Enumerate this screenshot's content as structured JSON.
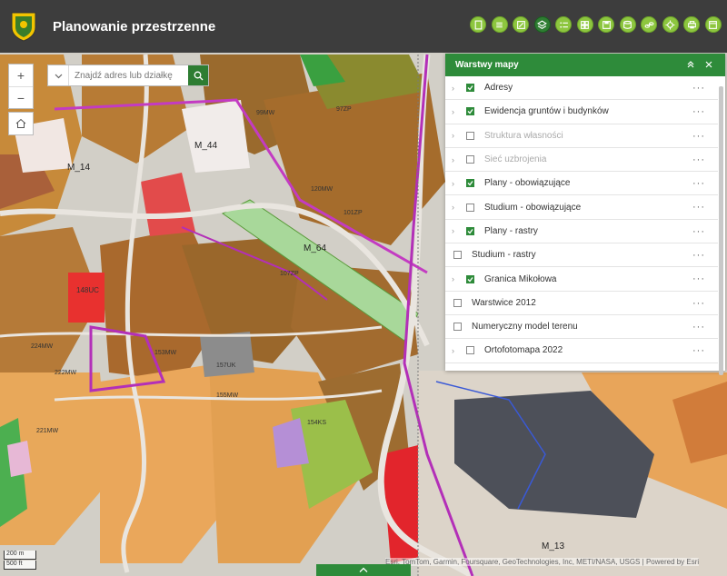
{
  "header": {
    "title": "Planowanie przestrzenne",
    "logo_icon": "crest-icon"
  },
  "toolbar": {
    "tools": [
      "document-icon",
      "list-icon",
      "frame-icon",
      "layers-icon",
      "legend-icon",
      "grid-icon",
      "save-icon",
      "database-icon",
      "link-icon",
      "locate-icon",
      "print-icon",
      "window-icon"
    ],
    "active_tool": "layers-icon",
    "accent": "#8dc63f"
  },
  "search": {
    "placeholder": "Znajdź adres lub działkę"
  },
  "zoom": {
    "plus": "+",
    "minus": "−"
  },
  "map_labels": {
    "m44": "M_44",
    "m14": "M_14",
    "m64": "M_64",
    "m13": "M_13",
    "u148": "148UC",
    "r120": "120MW",
    "r153": "153MW",
    "r157": "157UK",
    "r97": "97ZP",
    "r99": "99MW",
    "r222": "222MW",
    "r224": "224MW",
    "r221": "221MW",
    "r155": "155MW",
    "r154": "154KS",
    "r107": "107ZP",
    "r101": "101ZP"
  },
  "panel": {
    "title": "Warstwy mapy",
    "layers": [
      {
        "label": "Adresy",
        "checked": true,
        "chevron": true,
        "dim": false
      },
      {
        "label": "Ewidencja gruntów i budynków",
        "checked": true,
        "chevron": true,
        "dim": false
      },
      {
        "label": "Struktura własności",
        "checked": false,
        "chevron": true,
        "dim": true
      },
      {
        "label": "Sieć uzbrojenia",
        "checked": false,
        "chevron": true,
        "dim": true
      },
      {
        "label": "Plany - obowiązujące",
        "checked": true,
        "chevron": true,
        "dim": false
      },
      {
        "label": "Studium - obowiązujące",
        "checked": false,
        "chevron": true,
        "dim": false
      },
      {
        "label": "Plany - rastry",
        "checked": true,
        "chevron": true,
        "dim": false
      },
      {
        "label": "Studium - rastry",
        "checked": false,
        "chevron": false,
        "dim": false
      },
      {
        "label": "Granica Mikołowa",
        "checked": true,
        "chevron": true,
        "dim": false
      },
      {
        "label": "Warstwice 2012",
        "checked": false,
        "chevron": false,
        "dim": false
      },
      {
        "label": "Numeryczny model terenu",
        "checked": false,
        "chevron": false,
        "dim": false
      },
      {
        "label": "Ortofotomapa 2022",
        "checked": false,
        "chevron": true,
        "dim": false
      }
    ],
    "more": "···"
  },
  "scale": {
    "top": "200 m",
    "bottom": "500 ft"
  },
  "attribution": "Esri, TomTom, Garmin, Foursquare, GeoTechnologies, Inc, METI/NASA, USGS",
  "powered": "Powered by Esri"
}
